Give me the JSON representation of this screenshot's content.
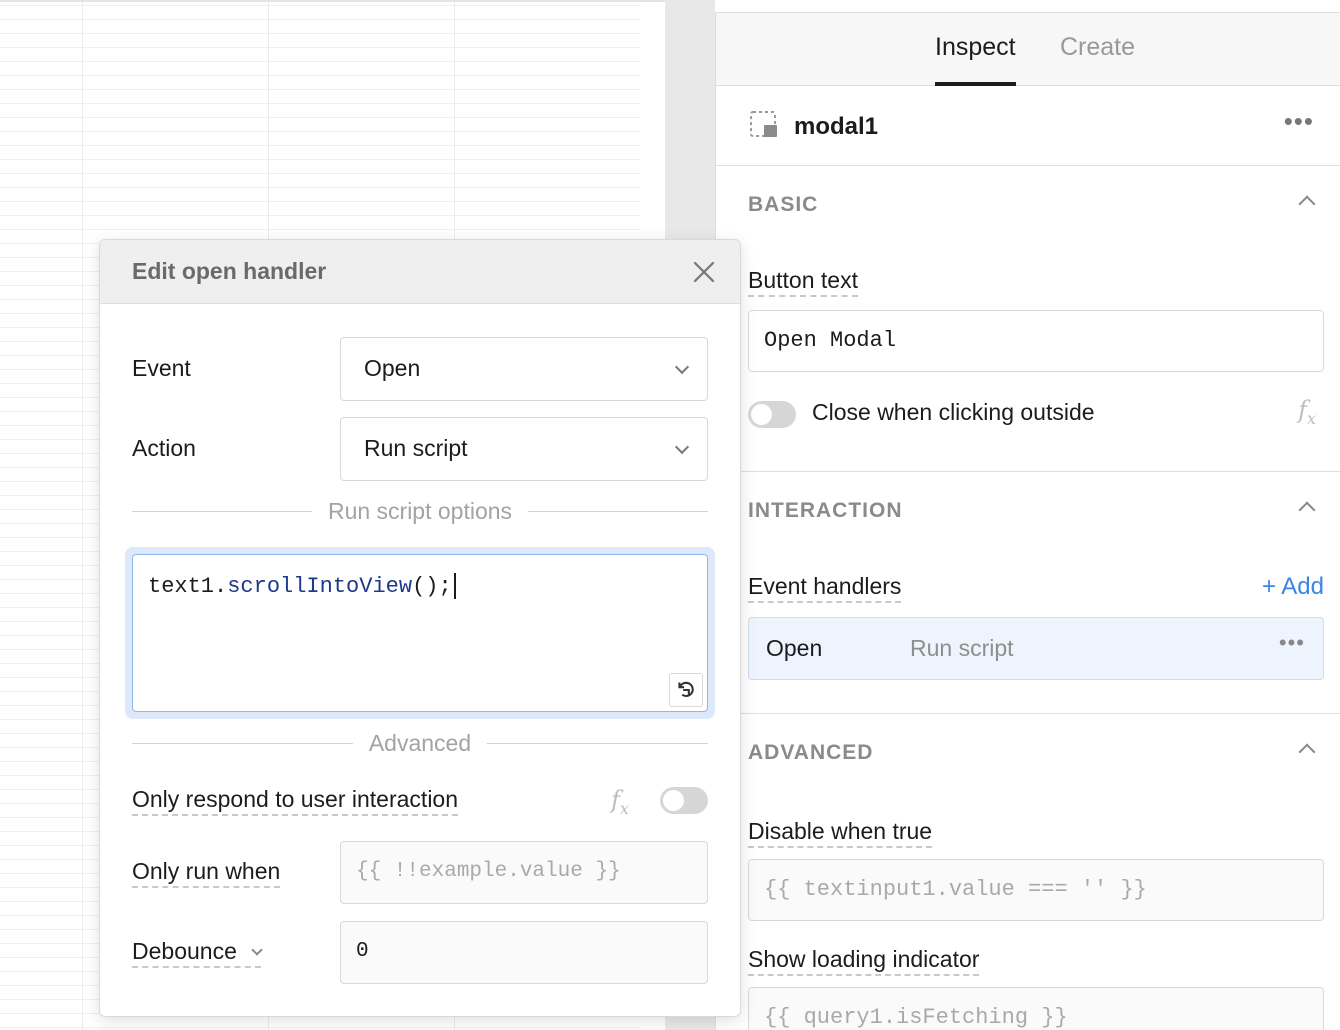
{
  "tabs": [
    {
      "label": "Inspect",
      "active": true
    },
    {
      "label": "Create",
      "active": false
    }
  ],
  "component": {
    "name": "modal1",
    "icon": "modal-icon",
    "menu_icon": "more-icon"
  },
  "basic": {
    "title": "BASIC",
    "button_text_label": "Button text",
    "button_text_value": "Open Modal",
    "close_outside_label": "Close when clicking outside",
    "close_outside_enabled": false
  },
  "interaction": {
    "title": "INTERACTION",
    "event_handlers_label": "Event handlers",
    "add_label": "+ Add",
    "handlers": [
      {
        "event": "Open",
        "action": "Run script"
      }
    ]
  },
  "advanced": {
    "title": "ADVANCED",
    "disable_label": "Disable when true",
    "disable_placeholder": "{{ textinput1.value === '' }}",
    "loading_label": "Show loading indicator",
    "loading_placeholder": "{{ query1.isFetching }}"
  },
  "modal": {
    "title": "Edit open handler",
    "event_label": "Event",
    "event_value": "Open",
    "action_label": "Action",
    "action_value": "Run script",
    "run_script_divider": "Run script options",
    "code": {
      "object": "text1",
      "dot": ".",
      "method": "scrollIntoView",
      "rest": "();"
    },
    "advanced_divider": "Advanced",
    "only_user_label": "Only respond to user interaction",
    "only_user_enabled": false,
    "only_run_label": "Only run when",
    "only_run_placeholder": "{{ !!example.value }}",
    "debounce_label": "Debounce",
    "debounce_value": "0"
  },
  "fx_label": "fx"
}
